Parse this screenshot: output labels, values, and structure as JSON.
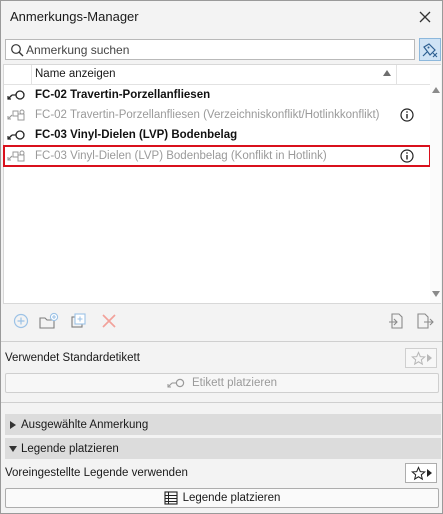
{
  "window": {
    "title": "Anmerkungs-Manager"
  },
  "search": {
    "placeholder": "Anmerkung suchen",
    "value": ""
  },
  "list": {
    "column_header": "Name anzeigen",
    "rows": [
      {
        "label": "FC-02 Travertin-Porzellanfliesen",
        "style": "bold",
        "icon": "linked-tag-icon",
        "info": false
      },
      {
        "label": "FC-02 Travertin-Porzellanfliesen (Verzeichniskonflikt/Hotlinkkonflikt)",
        "style": "dim",
        "icon": "conflict-tag-icon",
        "info": true
      },
      {
        "label": "FC-03 Vinyl-Dielen (LVP) Bodenbelag",
        "style": "bold",
        "icon": "linked-tag-icon",
        "info": false
      },
      {
        "label": "FC-03 Vinyl-Dielen (LVP) Bodenbelag (Konflikt in Hotlink)",
        "style": "dim",
        "icon": "conflict-tag-icon",
        "info": true,
        "selected": true
      }
    ]
  },
  "default_label": {
    "heading": "Verwendet Standardetikett",
    "place_button": "Etikett platzieren"
  },
  "panels": {
    "selected_annotation": "Ausgewählte Anmerkung",
    "place_legend": "Legende platzieren"
  },
  "legend": {
    "heading": "Voreingestellte Legende verwenden",
    "place_button": "Legende platzieren"
  },
  "colors": {
    "selection_outline": "#d9101c",
    "accent": "#3d7ab8"
  }
}
